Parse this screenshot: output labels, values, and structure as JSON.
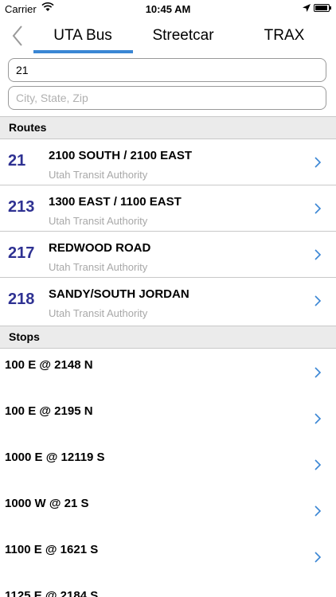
{
  "status_bar": {
    "carrier": "Carrier",
    "time": "10:45 AM"
  },
  "nav": {
    "tabs": [
      {
        "label": "UTA Bus",
        "selected": true
      },
      {
        "label": "Streetcar",
        "selected": false
      },
      {
        "label": "TRAX",
        "selected": false
      }
    ]
  },
  "search": {
    "route_value": "21",
    "location_placeholder": "City, State, Zip"
  },
  "routes": {
    "header": "Routes",
    "items": [
      {
        "number": "21",
        "name": "2100 SOUTH / 2100 EAST",
        "agency": "Utah Transit Authority"
      },
      {
        "number": "213",
        "name": "1300 EAST / 1100 EAST",
        "agency": "Utah Transit Authority"
      },
      {
        "number": "217",
        "name": "REDWOOD ROAD",
        "agency": "Utah Transit Authority"
      },
      {
        "number": "218",
        "name": "SANDY/SOUTH JORDAN",
        "agency": "Utah Transit Authority"
      }
    ]
  },
  "stops": {
    "header": "Stops",
    "items": [
      {
        "name": "100 E @ 2148 N"
      },
      {
        "name": "100 E @ 2195 N"
      },
      {
        "name": "1000 E @ 12119 S"
      },
      {
        "name": "1000 W @ 21 S"
      },
      {
        "name": "1100 E @ 1621 S"
      },
      {
        "name": "1125 E @ 2184 S"
      }
    ]
  },
  "colors": {
    "accent": "#3a86d4",
    "route_number": "#2e3192",
    "secondary_text": "#a8a8a8"
  }
}
